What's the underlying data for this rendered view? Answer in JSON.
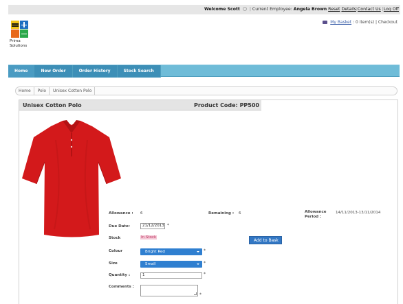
{
  "topbar": {
    "welcome": "Welcome Scott",
    "employee_label": "Current Employee:",
    "employee_name": "Angela Brown",
    "links": {
      "reset": "Reset",
      "details": "Details",
      "contact": "Contact Us",
      "logoff": "Log Off"
    }
  },
  "logo": {
    "line1": "Prima",
    "line2": "Solutions"
  },
  "basket": {
    "link": "My Basket",
    "count": ": 0 item(s)",
    "checkout": "Checkout"
  },
  "nav": {
    "tabs": [
      "Home",
      "New Order",
      "Order History",
      "Stock Search"
    ]
  },
  "breadcrumb": [
    "Home",
    "Polo",
    "Unisex Cotton Polo"
  ],
  "product": {
    "title": "Unisex Cotton Polo",
    "code_label": "Product Code: PP500",
    "color_hex": "#d3191b"
  },
  "fields": {
    "allowance_label": "Allowance :",
    "allowance_value": "6",
    "remaining_label": "Remaining :",
    "remaining_value": "6",
    "period_label_1": "Allowance",
    "period_label_2": "Period :",
    "period_value": "14/11/2013-13/11/2014",
    "due_label": "Due Date:",
    "due_value": "21/12/2013",
    "stock_label": "Stock",
    "stock_value": "In Stock",
    "colour_label": "Colour",
    "colour_value": "Bright Red",
    "size_label": "Size",
    "size_value": "Small",
    "quantity_label": "Quantity :",
    "quantity_value": "1",
    "comments_label": "Comments :",
    "required_mark": "*"
  },
  "buttons": {
    "add_to_basket": "Add to Bask"
  },
  "colors": {
    "nav_bg": "#6fbcd8",
    "select_bg": "#2f7fd0",
    "button_bg": "#3277c4",
    "instock_bg": "#f3c6d4"
  }
}
